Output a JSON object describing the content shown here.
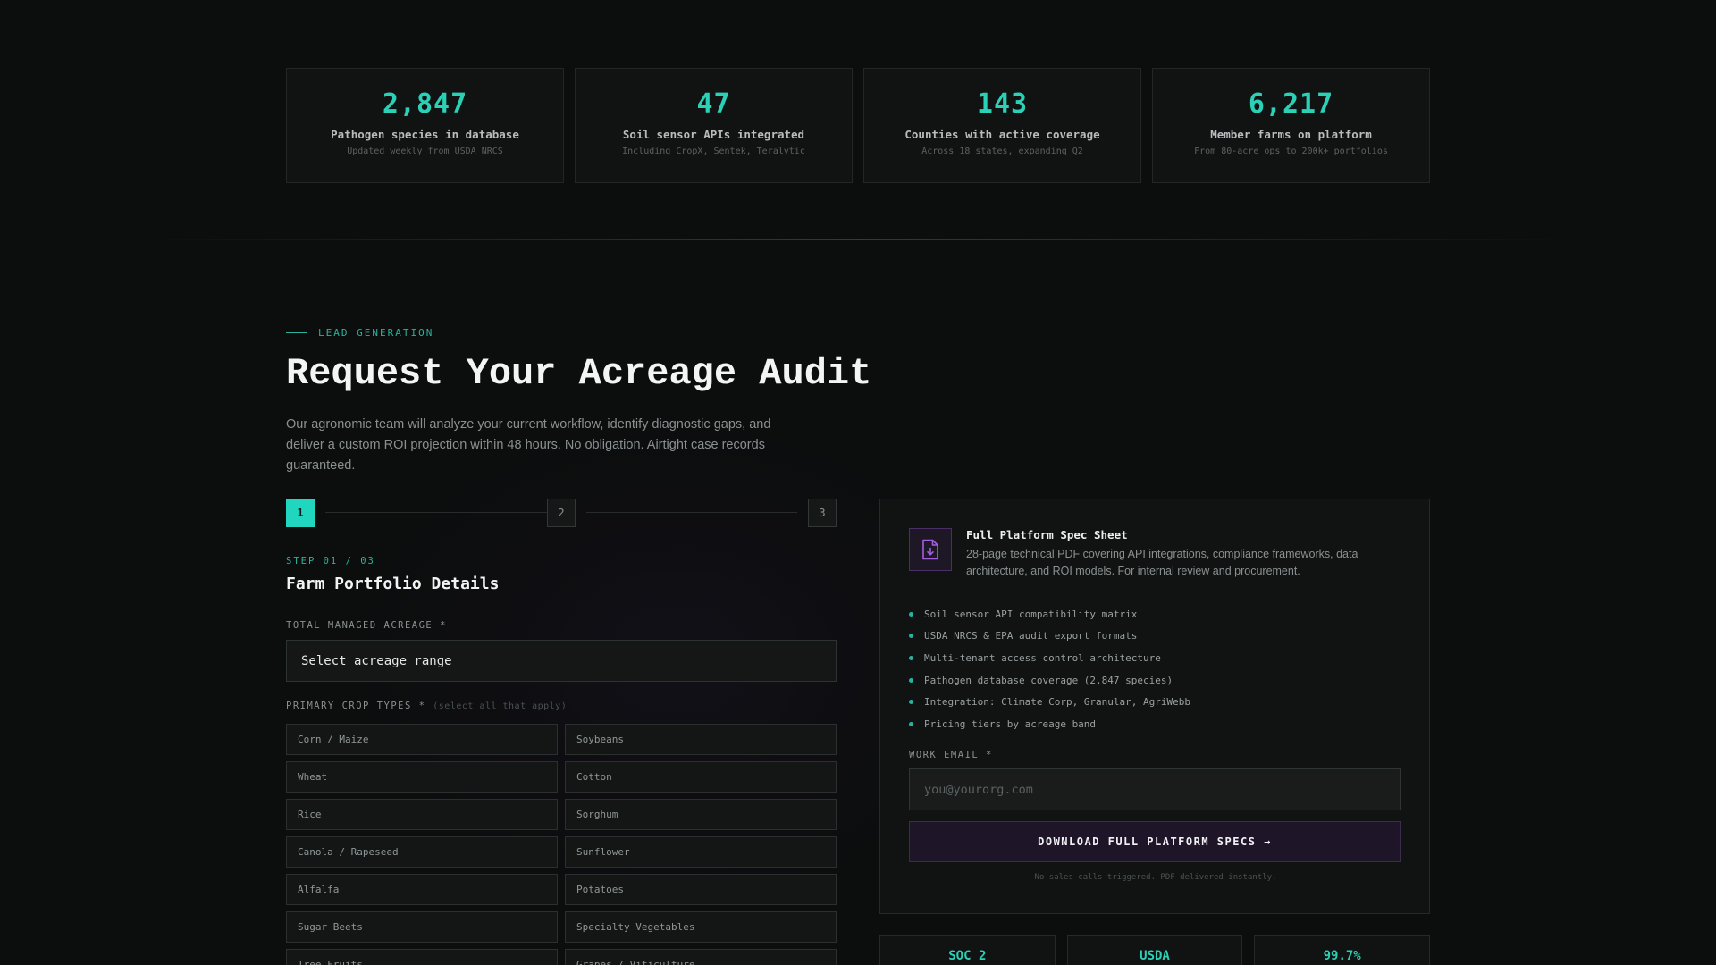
{
  "stats": [
    {
      "value": "2,847",
      "label": "Pathogen species in database",
      "sub": "Updated weekly from USDA NRCS"
    },
    {
      "value": "47",
      "label": "Soil sensor APIs integrated",
      "sub": "Including CropX, Sentek, Teralytic"
    },
    {
      "value": "143",
      "label": "Counties with active coverage",
      "sub": "Across 18 states, expanding Q2"
    },
    {
      "value": "6,217",
      "label": "Member farms on platform",
      "sub": "From 80-acre ops to 200k+ portfolios"
    }
  ],
  "hero": {
    "eyebrow": "LEAD GENERATION",
    "title": "Request Your Acreage Audit",
    "intro": "Our agronomic team will analyze your current workflow, identify diagnostic gaps, and deliver a custom ROI projection within 48 hours. No obligation. Airtight case records guaranteed."
  },
  "stepper": {
    "steps": [
      "1",
      "2",
      "3"
    ],
    "active_step": 1
  },
  "form": {
    "step_label": "STEP 01 / 03",
    "section_title": "Farm Portfolio Details",
    "acreage_label": "TOTAL MANAGED ACREAGE *",
    "acreage_value": "Select acreage range",
    "crops_label": "PRIMARY CROP TYPES *",
    "crops_hint": "(select all that apply)",
    "crops": [
      "Corn / Maize",
      "Soybeans",
      "Wheat",
      "Cotton",
      "Rice",
      "Sorghum",
      "Canola / Rapeseed",
      "Sunflower",
      "Alfalfa",
      "Potatoes",
      "Sugar Beets",
      "Specialty Vegetables",
      "Tree Fruits",
      "Grapes / Viticulture"
    ]
  },
  "spec_card": {
    "icon": "document-download-icon",
    "title": "Full Platform Spec Sheet",
    "description": "28-page technical PDF covering API integrations, compliance frameworks, data architecture, and ROI models. For internal review and procurement.",
    "features": [
      "Soil sensor API compatibility matrix",
      "USDA NRCS & EPA audit export formats",
      "Multi-tenant access control architecture",
      "Pathogen database coverage (2,847 species)",
      "Integration: Climate Corp, Granular, AgriWebb",
      "Pricing tiers by acreage band"
    ],
    "email_label": "WORK EMAIL *",
    "email_placeholder": "you@yourorg.com",
    "email_value": "",
    "button_label": "DOWNLOAD FULL PLATFORM SPECS →",
    "fine_print": "No sales calls triggered. PDF delivered instantly."
  },
  "badges": [
    "SOC 2",
    "USDA",
    "99.7%"
  ],
  "colors": {
    "accent": "#21d6bf",
    "accent_text": "#2ad1b6",
    "purple": "#9b4fd6",
    "background": "#0c0d0d"
  }
}
